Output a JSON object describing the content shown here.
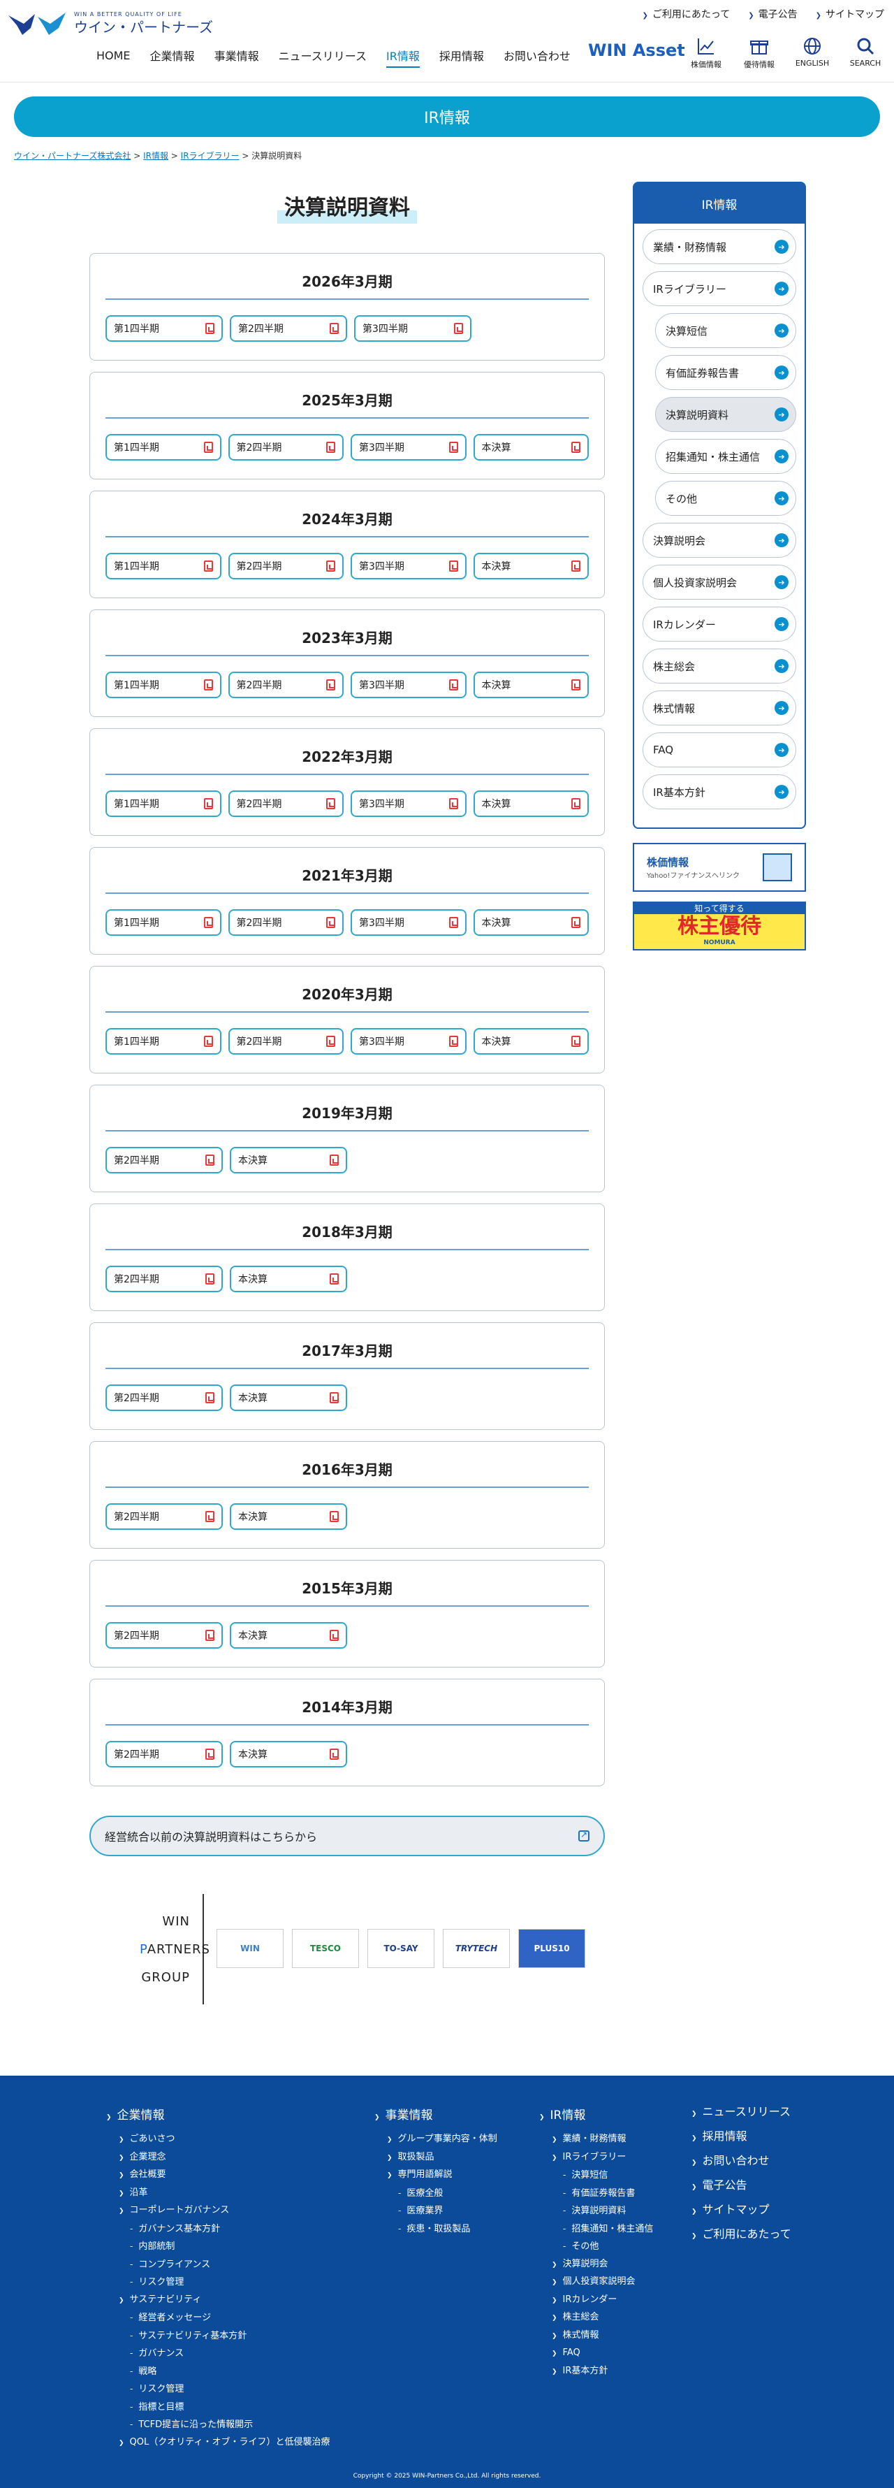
{
  "header": {
    "logo_tagline": "WIN A BETTER QUALITY OF LIFE",
    "logo_name": "ウイン・パートナーズ",
    "utility": [
      "ご利用にあたって",
      "電子公告",
      "サイトマップ"
    ],
    "nav": [
      "HOME",
      "企業情報",
      "事業情報",
      "ニュースリリース",
      "IR情報",
      "採用情報",
      "お問い合わせ"
    ],
    "win_asset": "WIN Asset",
    "icons": [
      {
        "label": "株価情報",
        "icon": "chart-icon"
      },
      {
        "label": "優待情報",
        "icon": "gift-icon"
      },
      {
        "label": "ENGLISH",
        "icon": "globe-icon"
      },
      {
        "label": "SEARCH",
        "icon": "search-icon"
      }
    ],
    "accent": "#1c3f94"
  },
  "banner": {
    "title": "IR情報",
    "color": "#0aa1cf"
  },
  "breadcrumb": [
    "ウイン・パートナーズ株式会社",
    "IR情報",
    "IRライブラリー",
    "決算説明資料"
  ],
  "page_title": "決算説明資料",
  "periods": [
    {
      "title": "2026年3月期",
      "docs": [
        "第1四半期",
        "第2四半期",
        "第3四半期"
      ]
    },
    {
      "title": "2025年3月期",
      "docs": [
        "第1四半期",
        "第2四半期",
        "第3四半期",
        "本決算"
      ]
    },
    {
      "title": "2024年3月期",
      "docs": [
        "第1四半期",
        "第2四半期",
        "第3四半期",
        "本決算"
      ]
    },
    {
      "title": "2023年3月期",
      "docs": [
        "第1四半期",
        "第2四半期",
        "第3四半期",
        "本決算"
      ]
    },
    {
      "title": "2022年3月期",
      "docs": [
        "第1四半期",
        "第2四半期",
        "第3四半期",
        "本決算"
      ]
    },
    {
      "title": "2021年3月期",
      "docs": [
        "第1四半期",
        "第2四半期",
        "第3四半期",
        "本決算"
      ]
    },
    {
      "title": "2020年3月期",
      "docs": [
        "第1四半期",
        "第2四半期",
        "第3四半期",
        "本決算"
      ]
    },
    {
      "title": "2019年3月期",
      "docs": [
        "第2四半期",
        "本決算"
      ]
    },
    {
      "title": "2018年3月期",
      "docs": [
        "第2四半期",
        "本決算"
      ]
    },
    {
      "title": "2017年3月期",
      "docs": [
        "第2四半期",
        "本決算"
      ]
    },
    {
      "title": "2016年3月期",
      "docs": [
        "第2四半期",
        "本決算"
      ]
    },
    {
      "title": "2015年3月期",
      "docs": [
        "第2四半期",
        "本決算"
      ]
    },
    {
      "title": "2014年3月期",
      "docs": [
        "第2四半期",
        "本決算"
      ]
    }
  ],
  "archive_link": "経営統合以前の決算説明資料はこちらから",
  "group": {
    "lines": [
      "WIN",
      "PARTNERS",
      "GROUP"
    ],
    "logos": [
      "WIN",
      "TESCO",
      "TO-SAY",
      "TRYTECH",
      "PLUS10"
    ]
  },
  "sidebar": {
    "title": "IR情報",
    "items": [
      {
        "label": "業績・財務情報",
        "sub": false,
        "current": false
      },
      {
        "label": "IRライブラリー",
        "sub": false,
        "current": false
      },
      {
        "label": "決算短信",
        "sub": true,
        "current": false
      },
      {
        "label": "有価証券報告書",
        "sub": true,
        "current": false
      },
      {
        "label": "決算説明資料",
        "sub": true,
        "current": true
      },
      {
        "label": "招集通知・株主通信",
        "sub": true,
        "current": false
      },
      {
        "label": "その他",
        "sub": true,
        "current": false
      },
      {
        "label": "決算説明会",
        "sub": false,
        "current": false
      },
      {
        "label": "個人投資家説明会",
        "sub": false,
        "current": false
      },
      {
        "label": "IRカレンダー",
        "sub": false,
        "current": false
      },
      {
        "label": "株主総会",
        "sub": false,
        "current": false
      },
      {
        "label": "株式情報",
        "sub": false,
        "current": false
      },
      {
        "label": "FAQ",
        "sub": false,
        "current": false
      },
      {
        "label": "IR基本方針",
        "sub": false,
        "current": false
      }
    ],
    "banner_stock": {
      "title": "株価情報",
      "sub": "Yahoo!ファイナンスへリンク"
    },
    "banner_benefit": {
      "top": "知って得する",
      "main": "株主優待",
      "bottom": "NOMURA"
    }
  },
  "footer": {
    "corporate": {
      "title": "企業情報",
      "links": [
        {
          "t": "ごあいさつ",
          "l": 1
        },
        {
          "t": "企業理念",
          "l": 1
        },
        {
          "t": "会社概要",
          "l": 1
        },
        {
          "t": "沿革",
          "l": 1
        },
        {
          "t": "コーポレートガバナンス",
          "l": 1
        },
        {
          "t": "ガバナンス基本方針",
          "l": 2
        },
        {
          "t": "内部統制",
          "l": 2
        },
        {
          "t": "コンプライアンス",
          "l": 2
        },
        {
          "t": "リスク管理",
          "l": 2
        },
        {
          "t": "サステナビリティ",
          "l": 1
        },
        {
          "t": "経営者メッセージ",
          "l": 2
        },
        {
          "t": "サステナビリティ基本方針",
          "l": 2
        },
        {
          "t": "ガバナンス",
          "l": 2
        },
        {
          "t": "戦略",
          "l": 2
        },
        {
          "t": "リスク管理",
          "l": 2
        },
        {
          "t": "指標と目標",
          "l": 2
        },
        {
          "t": "TCFD提言に沿った情報開示",
          "l": 2
        },
        {
          "t": "QOL（クオリティ・オブ・ライフ）と低侵襲治療",
          "l": 1
        }
      ]
    },
    "business": {
      "title": "事業情報",
      "links": [
        {
          "t": "グループ事業内容・体制",
          "l": 1
        },
        {
          "t": "取扱製品",
          "l": 1
        },
        {
          "t": "専門用語解説",
          "l": 1
        },
        {
          "t": "医療全般",
          "l": 2
        },
        {
          "t": "医療業界",
          "l": 2
        },
        {
          "t": "疾患・取扱製品",
          "l": 2
        }
      ]
    },
    "ir": {
      "title": "IR情報",
      "links": [
        {
          "t": "業績・財務情報",
          "l": 1
        },
        {
          "t": "IRライブラリー",
          "l": 1
        },
        {
          "t": "決算短信",
          "l": 2
        },
        {
          "t": "有価証券報告書",
          "l": 2
        },
        {
          "t": "決算説明資料",
          "l": 2
        },
        {
          "t": "招集通知・株主通信",
          "l": 2
        },
        {
          "t": "その他",
          "l": 2
        },
        {
          "t": "決算説明会",
          "l": 1
        },
        {
          "t": "個人投資家説明会",
          "l": 1
        },
        {
          "t": "IRカレンダー",
          "l": 1
        },
        {
          "t": "株主総会",
          "l": 1
        },
        {
          "t": "株式情報",
          "l": 1
        },
        {
          "t": "FAQ",
          "l": 1
        },
        {
          "t": "IR基本方針",
          "l": 1
        }
      ]
    },
    "right": [
      "ニュースリリース",
      "採用情報",
      "お問い合わせ",
      "電子公告",
      "サイトマップ",
      "ご利用にあたって"
    ],
    "copyright": "Copyright © 2025 WIN-Partners Co.,Ltd. All rights reserved."
  }
}
